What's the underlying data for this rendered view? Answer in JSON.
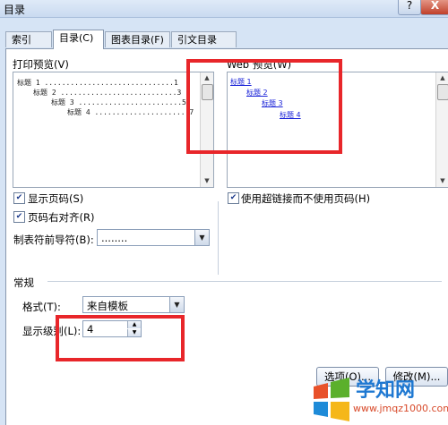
{
  "window": {
    "title": "目录",
    "help": "?",
    "close": "X"
  },
  "tabs": [
    {
      "label": "索引(X)"
    },
    {
      "label": "目录(C)"
    },
    {
      "label": "图表目录(F)"
    },
    {
      "label": "引文目录(A)"
    }
  ],
  "print_preview": {
    "label": "打印预览(V)",
    "lines": [
      {
        "text": "标题 1 ..............................1"
      },
      {
        "text": "标题 2 ...........................3"
      },
      {
        "text": "标题 3 ........................5"
      },
      {
        "text": "标题 4 ......................7"
      }
    ]
  },
  "web_preview": {
    "label": "Web 预览(W)",
    "links": [
      "标题 1",
      "标题 2",
      "标题 3",
      "标题 4"
    ]
  },
  "options": {
    "show_page_numbers": "显示页码(S)",
    "right_align": "页码右对齐(R)",
    "tab_leader_label": "制表符前导符(B):",
    "tab_leader_value": "........",
    "use_hyperlinks": "使用超链接而不使用页码(H)"
  },
  "general": {
    "section_label": "常规",
    "format_label": "格式(T):",
    "format_value": "来自模板",
    "levels_label": "显示级别(L):",
    "levels_value": "4"
  },
  "buttons": {
    "options": "选项(O)...",
    "modify": "修改(M)..."
  },
  "watermark": {
    "brand": "学知网",
    "url": "www.jmqz1000.com"
  },
  "accent_colors": {
    "red_highlight": "#e8262a",
    "link_blue": "#1a23d8"
  }
}
